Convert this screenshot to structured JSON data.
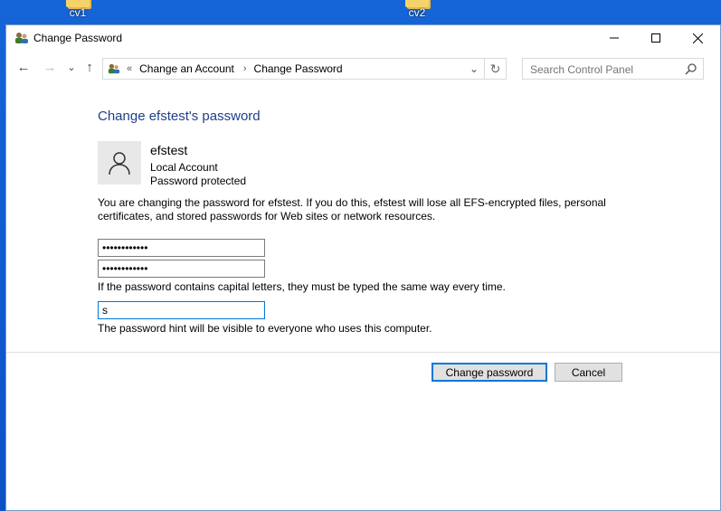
{
  "desktop": {
    "icons": [
      {
        "label": "cv1"
      },
      {
        "label": "cv2"
      }
    ]
  },
  "window": {
    "title": "Change Password",
    "minimize_glyph": "—",
    "maximize_glyph": "☐",
    "close_glyph": "✕"
  },
  "nav": {
    "back_glyph": "←",
    "forward_glyph": "→",
    "recent_glyph": "⌄",
    "up_glyph": "↑",
    "breadcrumb_chevron": "«",
    "breadcrumbs": [
      "Change an Account",
      "Change Password"
    ],
    "breadcrumb_sep": "›",
    "dropdown_glyph": "⌄",
    "refresh_glyph": "↻",
    "search_placeholder": "Search Control Panel"
  },
  "main": {
    "heading": "Change efstest's password",
    "user": {
      "name": "efstest",
      "account_type": "Local Account",
      "protection": "Password protected"
    },
    "warning": "You are changing the password for efstest.  If you do this, efstest will lose all EFS-encrypted files, personal certificates, and stored passwords for Web sites or network resources.",
    "new_password_value": "••••••••••••",
    "confirm_password_value": "••••••••••••",
    "capital_note": "If the password contains capital letters, they must be typed the same way every time.",
    "hint_value": "s",
    "hint_note": "The password hint will be visible to everyone who uses this computer.",
    "change_button": "Change password",
    "cancel_button": "Cancel"
  },
  "colors": {
    "heading": "#1e3f8a",
    "focus_border": "#0078d7",
    "desktop": "#1565d8"
  }
}
